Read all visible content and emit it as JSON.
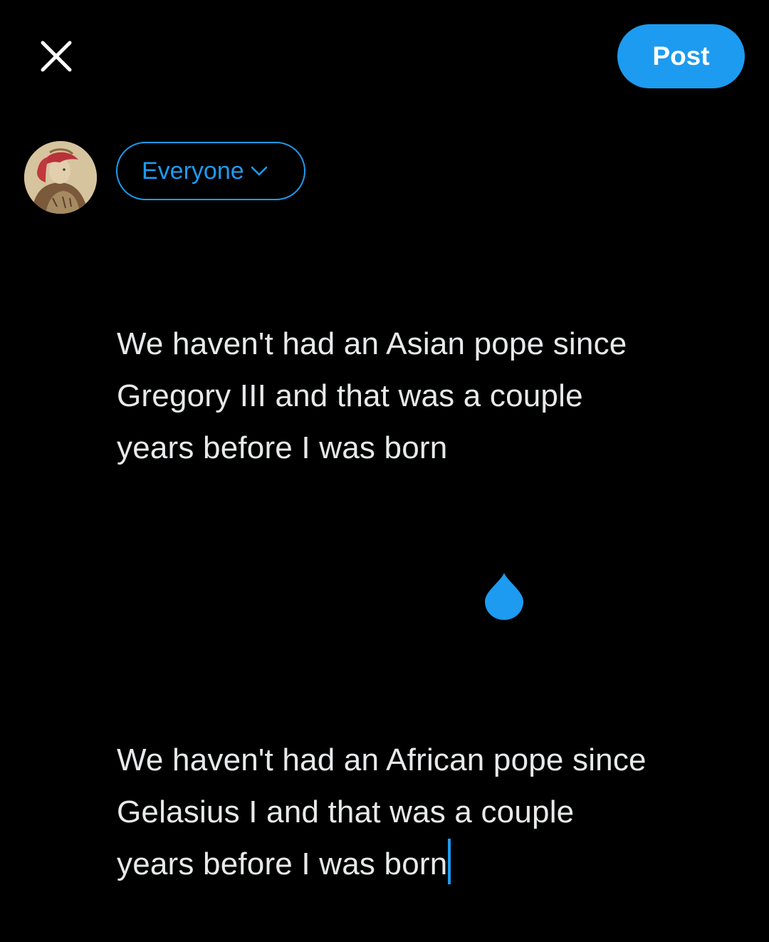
{
  "header": {
    "close_icon": "close-icon",
    "post_label": "Post"
  },
  "colors": {
    "background": "#000000",
    "accent": "#1d9bf0",
    "text": "#e7e9ea"
  },
  "composer": {
    "avatar_icon": "avatar",
    "audience_label": "Everyone",
    "audience_icon": "chevron-down-icon",
    "paragraphs": [
      "We haven't had an Asian pope since Gregory III and that was a couple years before I was born",
      "We haven't had an African pope since Gelasius I and that was a couple years before I was born"
    ],
    "lines": [
      "We haven't had an Asian pope since",
      "Gregory III and that was a couple",
      "years before I was born",
      "We haven't had an African pope since",
      "Gelasius I and that was a couple",
      "years before I was born"
    ]
  }
}
